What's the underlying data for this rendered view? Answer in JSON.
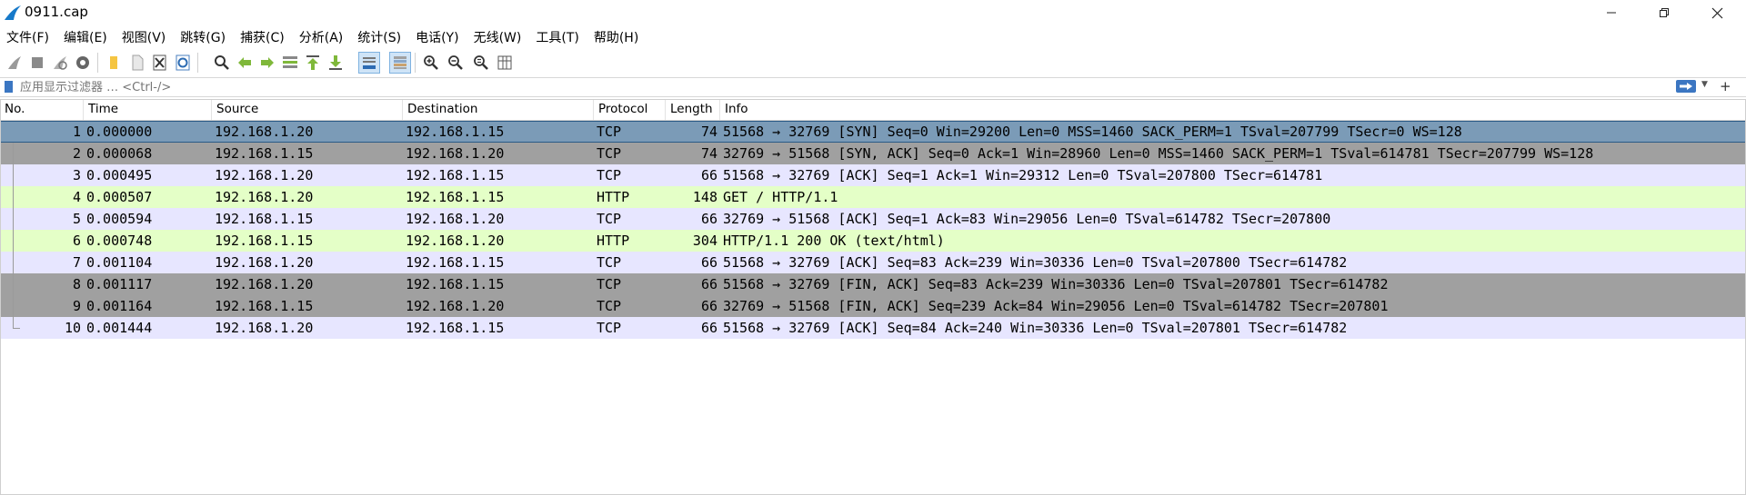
{
  "window": {
    "title": "0911.cap",
    "app_icon": "wireshark-fin-icon",
    "controls": [
      "minimize-icon",
      "maximize-icon",
      "close-icon"
    ]
  },
  "menu": [
    "文件(F)",
    "编辑(E)",
    "视图(V)",
    "跳转(G)",
    "捕获(C)",
    "分析(A)",
    "统计(S)",
    "电话(Y)",
    "无线(W)",
    "工具(T)",
    "帮助(H)"
  ],
  "toolbar": {
    "icons": [
      "start-capture-icon",
      "stop-capture-icon",
      "restart-capture-icon",
      "capture-options-icon",
      "open-file-icon",
      "save-file-icon",
      "close-file-icon",
      "reload-file-icon",
      "find-packet-icon",
      "go-back-icon",
      "go-forward-icon",
      "go-to-packet-icon",
      "go-first-packet-icon",
      "go-last-packet-icon",
      "autoscroll-icon",
      "colorize-icon",
      "zoom-in-icon",
      "zoom-out-icon",
      "zoom-normal-icon",
      "resize-columns-icon"
    ]
  },
  "filter": {
    "placeholder": "应用显示过滤器 … <Ctrl-/>",
    "icons": [
      "bookmark-icon",
      "apply-filter-arrow-icon",
      "dropdown-icon",
      "add-filter-button-icon"
    ]
  },
  "packet_list": {
    "columns": [
      "No.",
      "Time",
      "Source",
      "Destination",
      "Protocol",
      "Length",
      "Info"
    ],
    "colors": {
      "tcp": "#e7e6ff",
      "http": "#e4ffc7",
      "syn_fin": "#a0a0a0",
      "selected": "#7b9bb7"
    },
    "rows": [
      {
        "no": "1",
        "time": "0.000000",
        "src": "192.168.1.20",
        "dst": "192.168.1.15",
        "proto": "TCP",
        "len": "74",
        "info": "51568 → 32769 [SYN] Seq=0 Win=29200 Len=0 MSS=1460 SACK_PERM=1 TSval=207799 TSecr=0 WS=128",
        "style": "selected"
      },
      {
        "no": "2",
        "time": "0.000068",
        "src": "192.168.1.15",
        "dst": "192.168.1.20",
        "proto": "TCP",
        "len": "74",
        "info": "32769 → 51568 [SYN, ACK] Seq=0 Ack=1 Win=28960 Len=0 MSS=1460 SACK_PERM=1 TSval=614781 TSecr=207799 WS=128",
        "style": "syn_fin"
      },
      {
        "no": "3",
        "time": "0.000495",
        "src": "192.168.1.20",
        "dst": "192.168.1.15",
        "proto": "TCP",
        "len": "66",
        "info": "51568 → 32769 [ACK] Seq=1 Ack=1 Win=29312 Len=0 TSval=207800 TSecr=614781",
        "style": "tcp"
      },
      {
        "no": "4",
        "time": "0.000507",
        "src": "192.168.1.20",
        "dst": "192.168.1.15",
        "proto": "HTTP",
        "len": "148",
        "info": "GET / HTTP/1.1",
        "style": "http"
      },
      {
        "no": "5",
        "time": "0.000594",
        "src": "192.168.1.15",
        "dst": "192.168.1.20",
        "proto": "TCP",
        "len": "66",
        "info": "32769 → 51568 [ACK] Seq=1 Ack=83 Win=29056 Len=0 TSval=614782 TSecr=207800",
        "style": "tcp"
      },
      {
        "no": "6",
        "time": "0.000748",
        "src": "192.168.1.15",
        "dst": "192.168.1.20",
        "proto": "HTTP",
        "len": "304",
        "info": "HTTP/1.1 200 OK  (text/html)",
        "style": "http"
      },
      {
        "no": "7",
        "time": "0.001104",
        "src": "192.168.1.20",
        "dst": "192.168.1.15",
        "proto": "TCP",
        "len": "66",
        "info": "51568 → 32769 [ACK] Seq=83 Ack=239 Win=30336 Len=0 TSval=207800 TSecr=614782",
        "style": "tcp"
      },
      {
        "no": "8",
        "time": "0.001117",
        "src": "192.168.1.20",
        "dst": "192.168.1.15",
        "proto": "TCP",
        "len": "66",
        "info": "51568 → 32769 [FIN, ACK] Seq=83 Ack=239 Win=30336 Len=0 TSval=207801 TSecr=614782",
        "style": "syn_fin"
      },
      {
        "no": "9",
        "time": "0.001164",
        "src": "192.168.1.15",
        "dst": "192.168.1.20",
        "proto": "TCP",
        "len": "66",
        "info": "32769 → 51568 [FIN, ACK] Seq=239 Ack=84 Win=29056 Len=0 TSval=614782 TSecr=207801",
        "style": "syn_fin"
      },
      {
        "no": "10",
        "time": "0.001444",
        "src": "192.168.1.20",
        "dst": "192.168.1.15",
        "proto": "TCP",
        "len": "66",
        "info": "51568 → 32769 [ACK] Seq=84 Ack=240 Win=30336 Len=0 TSval=207801 TSecr=614782",
        "style": "tcp"
      }
    ]
  }
}
